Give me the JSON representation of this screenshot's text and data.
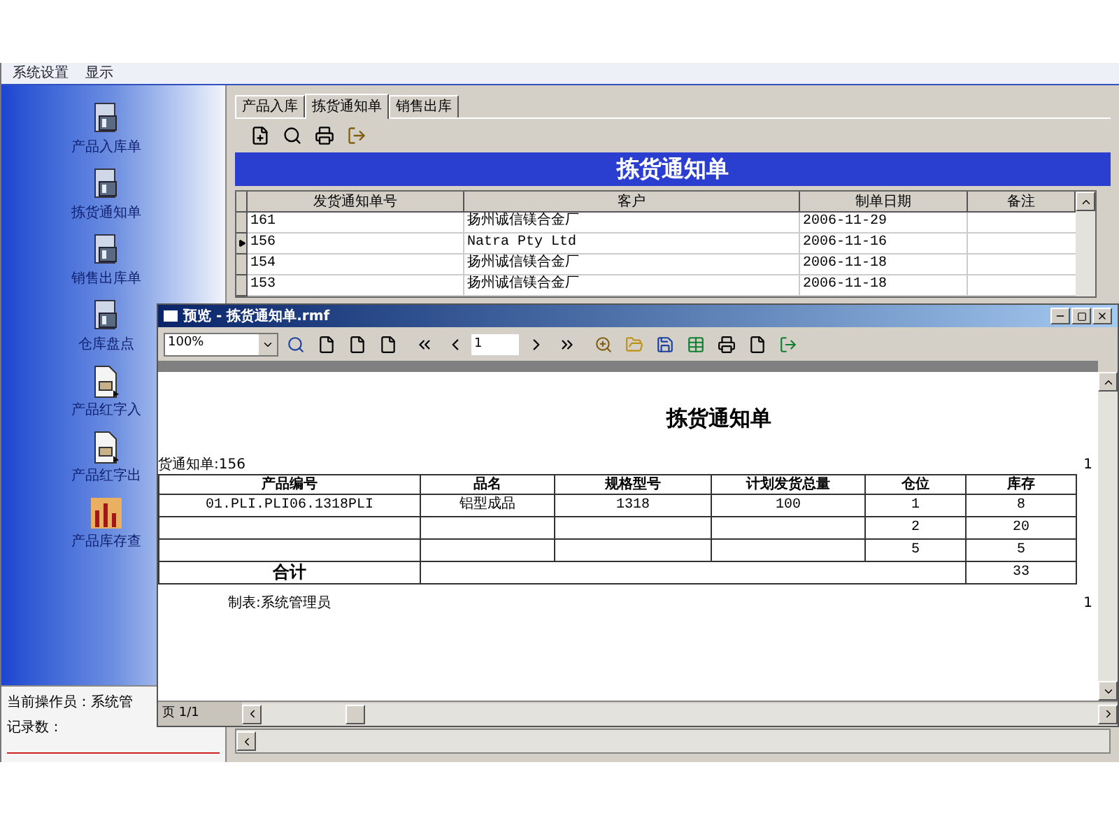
{
  "menu": [
    "系统设置",
    "显示"
  ],
  "sidebar": {
    "items": [
      {
        "label": "产品入库单",
        "kind": "doc"
      },
      {
        "label": "拣货通知单",
        "kind": "doc"
      },
      {
        "label": "销售出库单",
        "kind": "doc"
      },
      {
        "label": "仓库盘点",
        "kind": "doc"
      },
      {
        "label": "产品红字入",
        "kind": "page"
      },
      {
        "label": "产品红字出",
        "kind": "page"
      },
      {
        "label": "产品库存查",
        "kind": "chart"
      }
    ],
    "status": [
      "当前操作员：系统管",
      "记录数："
    ]
  },
  "tabs": [
    {
      "label": "产品入库",
      "selected": false
    },
    {
      "label": "拣货通知单",
      "selected": true
    },
    {
      "label": "销售出库",
      "selected": false
    }
  ],
  "banner": "拣货通知单",
  "grid": {
    "columns": [
      "发货通知单号",
      "客户",
      "制单日期",
      "备注"
    ],
    "rows": [
      {
        "number": "161",
        "customer": "扬州诚信镁合金厂",
        "date": "2006-11-29",
        "selected": false
      },
      {
        "number": "156",
        "customer": "Natra Pty Ltd",
        "date": "2006-11-16",
        "selected": true
      },
      {
        "number": "154",
        "customer": "扬州诚信镁合金厂",
        "date": "2006-11-18",
        "selected": false
      },
      {
        "number": "153",
        "customer": "扬州诚信镁合金厂",
        "date": "2006-11-18",
        "selected": false
      }
    ]
  },
  "preview": {
    "title": "预览 - 拣货通知单.rmf",
    "zoom": "100%",
    "page": "1",
    "report": {
      "title": "拣货通知单",
      "number_line": "货通知单:156",
      "edge_mark": "1",
      "columns": [
        "产品编号",
        "品名",
        "规格型号",
        "计划发货总量",
        "仓位",
        "库存"
      ],
      "rows": [
        {
          "product": "01.PLI.PLI06.1318PLI",
          "name": "铝型成品",
          "spec": "1318",
          "qty": "100",
          "bin": "1",
          "stock": "8"
        },
        {
          "bin": "2",
          "stock": "20"
        },
        {
          "bin": "5",
          "stock": "5"
        }
      ],
      "total_label": "合计",
      "total": "33",
      "footer": "制表:系统管理员",
      "footer_mark": "1"
    },
    "page_status": "页 1/1"
  }
}
